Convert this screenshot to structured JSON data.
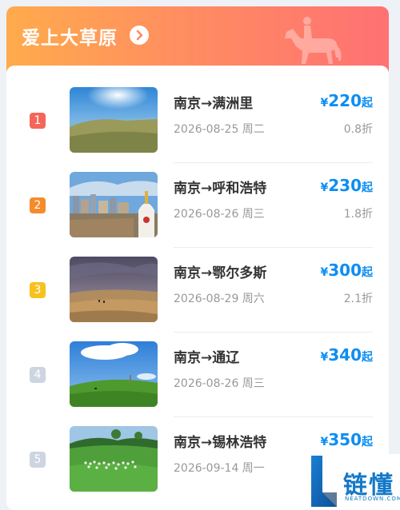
{
  "header": {
    "title": "爱上大草原",
    "accent_start": "#ffab4c",
    "accent_end": "#ff7173"
  },
  "items": [
    {
      "rank": "1",
      "rank_color": "#f4665a",
      "route": "南京→满洲里",
      "date": "2026-08-25 周二",
      "currency": "¥",
      "price": "220",
      "price_suffix": "起",
      "discount": "0.8折",
      "image": "grassland-lake-photo"
    },
    {
      "rank": "2",
      "rank_color": "#f58b2a",
      "route": "南京→呼和浩特",
      "date": "2026-08-26 周三",
      "currency": "¥",
      "price": "230",
      "price_suffix": "起",
      "discount": "1.8折",
      "image": "city-temple-photo"
    },
    {
      "rank": "3",
      "rank_color": "#f7c21d",
      "route": "南京→鄂尔多斯",
      "date": "2026-08-29 周六",
      "currency": "¥",
      "price": "300",
      "price_suffix": "起",
      "discount": "2.1折",
      "image": "desert-storm-photo"
    },
    {
      "rank": "4",
      "rank_color": "#ccd5e0",
      "route": "南京→通辽",
      "date": "2026-08-26 周三",
      "currency": "¥",
      "price": "340",
      "price_suffix": "起",
      "discount": "",
      "image": "green-hill-photo"
    },
    {
      "rank": "5",
      "rank_color": "#ccd5e0",
      "route": "南京→锡林浩特",
      "date": "2026-09-14 周一",
      "currency": "¥",
      "price": "350",
      "price_suffix": "起",
      "discount": "",
      "image": "sheep-meadow-photo"
    }
  ],
  "watermark": {
    "text": "链懂",
    "sub": "NEATDOWN.COM"
  }
}
